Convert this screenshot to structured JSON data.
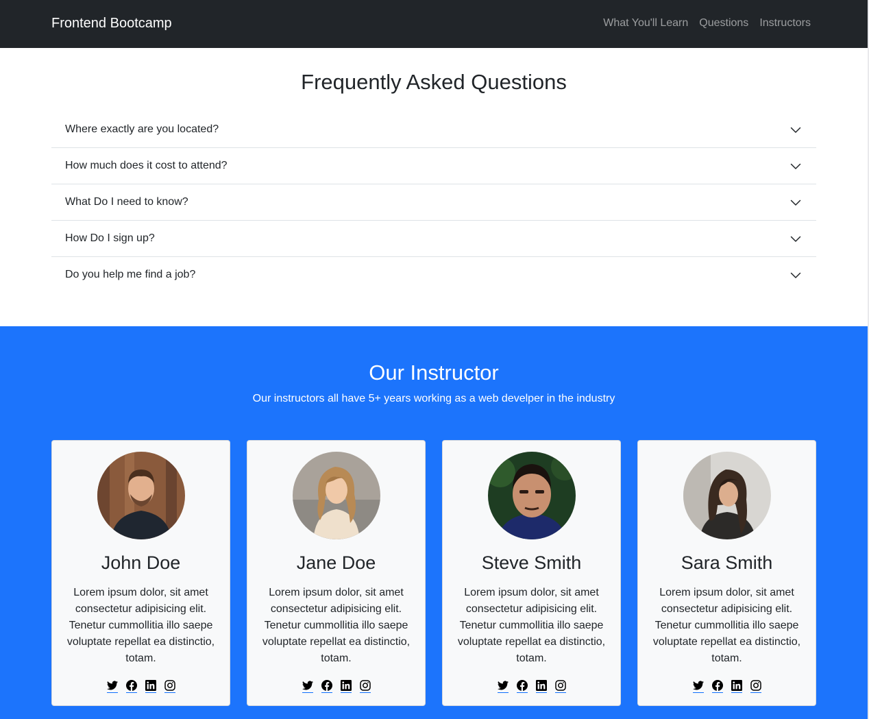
{
  "navbar": {
    "brand": "Frontend Bootcamp",
    "links": [
      "What You'll Learn",
      "Questions",
      "Instructors"
    ]
  },
  "faq": {
    "title": "Frequently Asked Questions",
    "questions": [
      "Where exactly are you located?",
      "How much does it cost to attend?",
      "What Do I need to know?",
      "How Do I sign up?",
      "Do you help me find a job?"
    ]
  },
  "instructors": {
    "title": "Our Instructor",
    "subtitle": "Our instructors all have 5+ years working as a web develper in the industry",
    "cards": [
      {
        "name": "John Doe",
        "bio": "Lorem ipsum dolor, sit amet consectetur adipisicing elit. Tenetur cummollitia illo saepe voluptate repellat ea distinctio, totam."
      },
      {
        "name": "Jane Doe",
        "bio": "Lorem ipsum dolor, sit amet consectetur adipisicing elit. Tenetur cummollitia illo saepe voluptate repellat ea distinctio, totam."
      },
      {
        "name": "Steve Smith",
        "bio": "Lorem ipsum dolor, sit amet consectetur adipisicing elit. Tenetur cummollitia illo saepe voluptate repellat ea distinctio, totam."
      },
      {
        "name": "Sara Smith",
        "bio": "Lorem ipsum dolor, sit amet consectetur adipisicing elit. Tenetur cummollitia illo saepe voluptate repellat ea distinctio, totam."
      }
    ],
    "social_icons": [
      "twitter-icon",
      "facebook-icon",
      "linkedin-icon",
      "instagram-icon"
    ]
  },
  "colors": {
    "navbar_bg": "#212529",
    "instructors_bg": "#1c74fc",
    "card_bg": "#f8f9fa",
    "link_underline": "#0d6efd"
  }
}
